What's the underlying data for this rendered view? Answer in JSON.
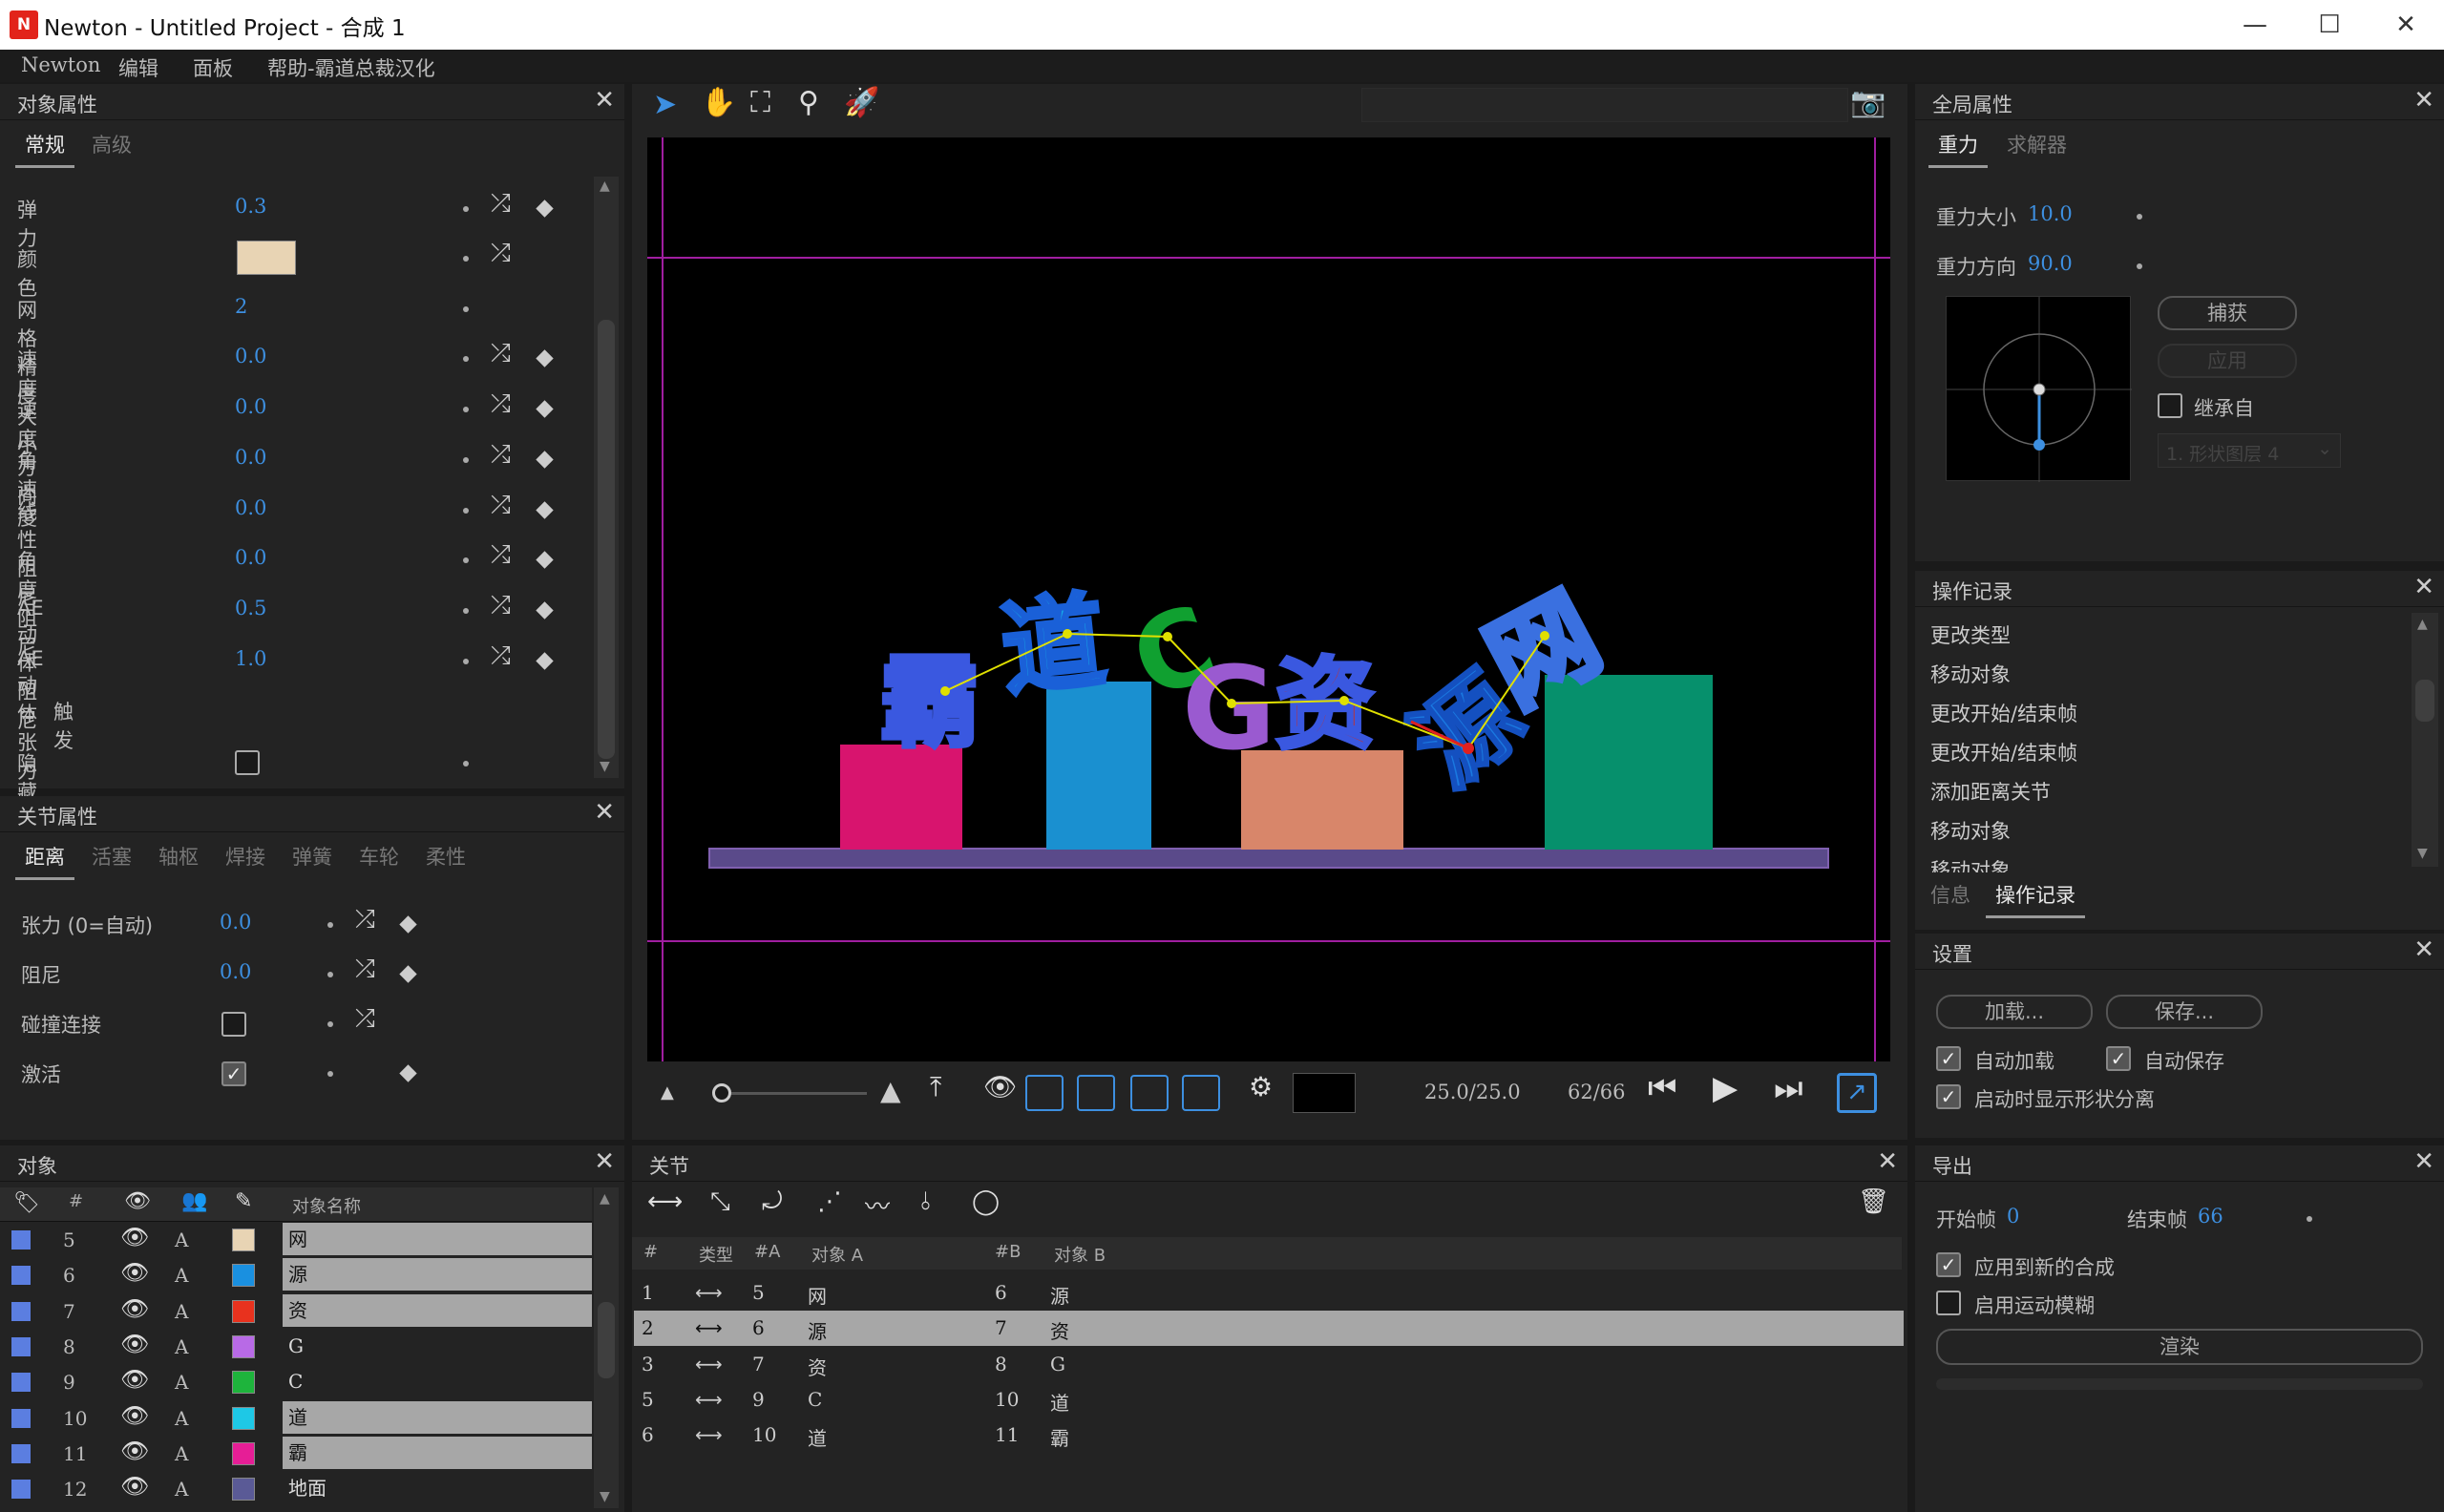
{
  "window": {
    "app_badge": "N",
    "title": "Newton - Untitled Project - 合成 1",
    "min": "—",
    "max": "☐",
    "close": "✕"
  },
  "menu": [
    "Newton",
    "编辑",
    "面板",
    "帮助-霸道总裁汉化"
  ],
  "object_properties": {
    "title": "对象属性",
    "tabs": [
      "常规",
      "高级"
    ],
    "rows": [
      {
        "label": "弹力",
        "value": "0.3"
      },
      {
        "label": "颜色",
        "value": "",
        "color": "#e8d4b4"
      },
      {
        "label": "网格精度",
        "value": "2"
      },
      {
        "label": "速度大小",
        "value": "0.0"
      },
      {
        "label": "速度方向",
        "value": "0.0"
      },
      {
        "label": "角速度",
        "value": "0.0"
      },
      {
        "label": "线性阻尼",
        "value": "0.0"
      },
      {
        "label": "角度阻尼",
        "value": "0.0"
      },
      {
        "label": "AE动体阻尼",
        "value": "0.5"
      },
      {
        "label": "AE动体张力",
        "value": "1.0"
      }
    ],
    "trigger": "触发",
    "hidden": "隐藏"
  },
  "joint_properties": {
    "title": "关节属性",
    "tabs": [
      "距离",
      "活塞",
      "轴枢",
      "焊接",
      "弹簧",
      "车轮",
      "柔性"
    ],
    "rows": [
      {
        "label": "张力 (0=自动)",
        "value": "0.0"
      },
      {
        "label": "阻尼",
        "value": "0.0"
      },
      {
        "label": "碰撞连接",
        "value": ""
      },
      {
        "label": "激活",
        "value": ""
      }
    ]
  },
  "objects": {
    "title": "对象",
    "col_num": "#",
    "col_name": "对象名称",
    "rows": [
      {
        "n": "5",
        "a": "A",
        "color": "#e8d4b4",
        "name": "网",
        "hl": true
      },
      {
        "n": "6",
        "a": "A",
        "color": "#1a90e0",
        "name": "源",
        "hl": true
      },
      {
        "n": "7",
        "a": "A",
        "color": "#e8321e",
        "name": "资",
        "hl": true
      },
      {
        "n": "8",
        "a": "A",
        "color": "#b86ae6",
        "name": "G",
        "hl": false
      },
      {
        "n": "9",
        "a": "A",
        "color": "#1eb43c",
        "name": "C",
        "hl": false
      },
      {
        "n": "10",
        "a": "A",
        "color": "#1ec8e6",
        "name": "道",
        "hl": true
      },
      {
        "n": "11",
        "a": "A",
        "color": "#e61e96",
        "name": "霸",
        "hl": true
      },
      {
        "n": "12",
        "a": "A",
        "color": "#5a5a96",
        "name": "地面",
        "hl": false
      }
    ]
  },
  "viewport": {
    "letters": [
      "霸",
      "道",
      "C",
      "G",
      "资",
      "源",
      "网"
    ],
    "time": "25.0/25.0",
    "frame": "62/66"
  },
  "joints": {
    "title": "关节",
    "headers": [
      "#",
      "类型",
      "#A",
      "对象 A",
      "#B",
      "对象 B"
    ],
    "rows": [
      {
        "n": "1",
        "a": "5",
        "oa": "网",
        "b": "6",
        "ob": "源",
        "hl": false
      },
      {
        "n": "2",
        "a": "6",
        "oa": "源",
        "b": "7",
        "ob": "资",
        "hl": true
      },
      {
        "n": "3",
        "a": "7",
        "oa": "资",
        "b": "8",
        "ob": "G",
        "hl": false
      },
      {
        "n": "5",
        "a": "9",
        "oa": "C",
        "b": "10",
        "ob": "道",
        "hl": false
      },
      {
        "n": "6",
        "a": "10",
        "oa": "道",
        "b": "11",
        "ob": "霸",
        "hl": false
      }
    ]
  },
  "global": {
    "title": "全局属性",
    "tabs": [
      "重力",
      "求解器"
    ],
    "gravity_size_label": "重力大小",
    "gravity_size": "10.0",
    "gravity_dir_label": "重力方向",
    "gravity_dir": "90.0",
    "capture": "捕获",
    "apply": "应用",
    "inherit": "继承自",
    "inherit_select": "1. 形状图层 4"
  },
  "history": {
    "title": "操作记录",
    "items": [
      "更改类型",
      "移动对象",
      "更改开始/结束帧",
      "更改开始/结束帧",
      "添加距离关节",
      "移动对象",
      "移动对象"
    ],
    "tabs": [
      "信息",
      "操作记录"
    ]
  },
  "settings": {
    "title": "设置",
    "load": "加载...",
    "save": "保存...",
    "auto_load": "自动加载",
    "auto_save": "自动保存",
    "show_shape_sep": "启动时显示形状分离"
  },
  "export": {
    "title": "导出",
    "start_label": "开始帧",
    "start": "0",
    "end_label": "结束帧",
    "end": "66",
    "apply_new": "应用到新的合成",
    "motion_blur": "启用运动模糊",
    "render": "渲染"
  }
}
